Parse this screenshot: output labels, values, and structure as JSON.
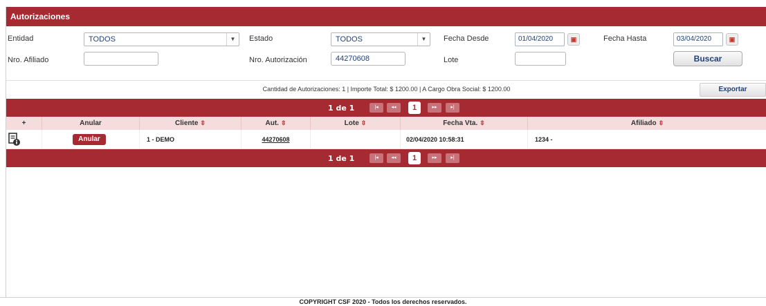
{
  "title": "Autorizaciones",
  "filters": {
    "entidad_label": "Entidad",
    "entidad_value": "TODOS",
    "estado_label": "Estado",
    "estado_value": "TODOS",
    "fecha_desde_label": "Fecha Desde",
    "fecha_desde_value": "01/04/2020",
    "fecha_hasta_label": "Fecha Hasta",
    "fecha_hasta_value": "03/04/2020",
    "nro_afiliado_label": "Nro. Afiliado",
    "nro_afiliado_value": "",
    "nro_autorizacion_label": "Nro. Autorización",
    "nro_autorizacion_value": "44270608",
    "lote_label": "Lote",
    "lote_value": "",
    "buscar_label": "Buscar"
  },
  "summary": {
    "text": "Cantidad de Autorizaciones: 1  |  Importe Total: $ 1200.00  |  A Cargo Obra Social: $ 1200.00",
    "exportar_label": "Exportar"
  },
  "pager": {
    "page_text": "1 de 1",
    "current_page": "1",
    "first": "|◂",
    "prev": "◂◂",
    "next": "▸▸",
    "last": "▸|"
  },
  "table": {
    "columns": [
      "+",
      "Anular",
      "Cliente",
      "Aut.",
      "Lote",
      "Fecha Vta.",
      "Afiliado"
    ],
    "sort_icon": "⇳",
    "rows": [
      {
        "icon": "document-info-icon",
        "anular_label": "Anular",
        "cliente": "1 - DEMO",
        "aut": "44270608",
        "lote": "",
        "fecha_vta": "02/04/2020 10:58:31",
        "afiliado": "1234 -"
      }
    ]
  },
  "footer": "COPYRIGHT CSF 2020 - Todos los derechos reservados.",
  "colors": {
    "brand": "#a52a31",
    "header_row": "#f6dcdc",
    "pager_button": "#c8727a"
  }
}
